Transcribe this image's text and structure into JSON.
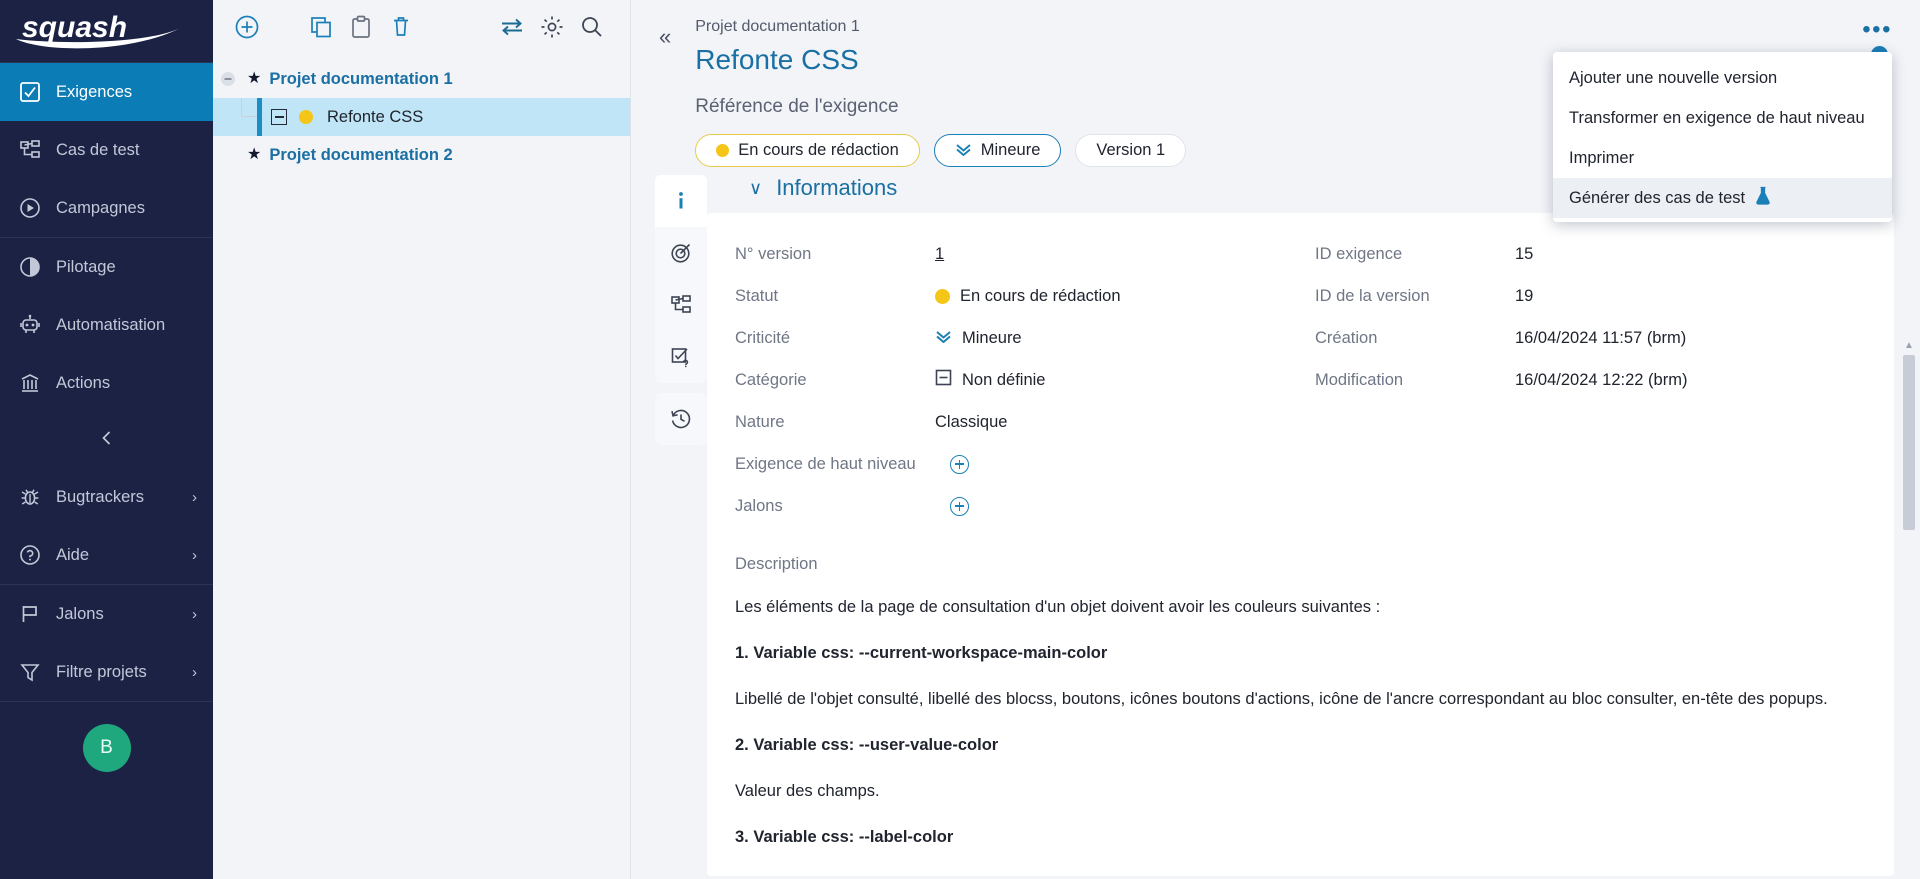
{
  "sidebar": {
    "logo_text": "squash",
    "items": [
      {
        "label": "Exigences",
        "icon": "checkbox-checked-icon",
        "active": true
      },
      {
        "label": "Cas de test",
        "icon": "test-case-tree-icon",
        "active": false
      },
      {
        "label": "Campagnes",
        "icon": "play-circle-icon",
        "active": false
      },
      {
        "label": "Pilotage",
        "icon": "pie-chart-icon",
        "active": false
      },
      {
        "label": "Automatisation",
        "icon": "robot-icon",
        "active": false
      },
      {
        "label": "Actions",
        "icon": "bank-icon",
        "active": false
      }
    ],
    "items_bottom": [
      {
        "label": "Bugtrackers",
        "icon": "bug-icon",
        "chevron": "›"
      },
      {
        "label": "Aide",
        "icon": "question-circle-icon",
        "chevron": "›"
      },
      {
        "label": "Jalons",
        "icon": "flag-icon",
        "chevron": "›"
      },
      {
        "label": "Filtre projets",
        "icon": "funnel-icon",
        "chevron": "›"
      }
    ],
    "collapse_icon": "chevron-left-icon",
    "avatar_initial": "B"
  },
  "tree": {
    "toolbar": [
      {
        "name": "add-icon",
        "title": "Ajouter"
      },
      {
        "name": "copy-icon",
        "title": "Copier"
      },
      {
        "name": "paste-clipboard-icon",
        "title": "Coller"
      },
      {
        "name": "trash-icon",
        "title": "Supprimer"
      },
      {
        "name": "transfer-arrows-icon",
        "title": "Déplacer"
      },
      {
        "name": "gear-icon",
        "title": "Paramètres"
      },
      {
        "name": "search-icon",
        "title": "Rechercher"
      }
    ],
    "nodes": [
      {
        "label": "Projet documentation 1",
        "level": 0,
        "expander": "minus",
        "icon": "star-icon",
        "selected": false
      },
      {
        "label": "Refonte CSS",
        "level": 1,
        "expander": "square-minus",
        "icon": "yellow-dot",
        "selected": true
      },
      {
        "label": "Projet documentation 2",
        "level": 0,
        "expander": "none",
        "icon": "star-icon",
        "selected": false
      }
    ]
  },
  "header": {
    "collapse_icon": "double-chevron-left-icon",
    "breadcrumb": "Projet documentation 1",
    "title": "Refonte CSS",
    "subtitle": "Référence de l'exigence",
    "badges": [
      {
        "label": "En cours de rédaction",
        "kind": "status",
        "icon": "yellow-dot"
      },
      {
        "label": "Mineure",
        "kind": "criticality",
        "icon": "double-chevron-down-icon"
      },
      {
        "label": "Version 1",
        "kind": "version",
        "icon": "none"
      }
    ],
    "kebab_icon": "more-options-icon",
    "kebab_glyph": "•••"
  },
  "dropdown": {
    "items": [
      {
        "label": "Ajouter une nouvelle version",
        "icon": "none",
        "highlighted": false
      },
      {
        "label": "Transformer en exigence de haut niveau",
        "icon": "none",
        "highlighted": false
      },
      {
        "label": "Imprimer",
        "icon": "none",
        "highlighted": false
      },
      {
        "label": "Générer des cas de test",
        "icon": "flask-icon",
        "highlighted": true
      }
    ]
  },
  "rail": {
    "items": [
      {
        "name": "information-icon",
        "active": true
      },
      {
        "name": "target-coverage-icon",
        "active": false
      },
      {
        "name": "hierarchy-tree-icon",
        "active": false
      },
      {
        "name": "verify-checklist-icon",
        "active": false
      }
    ],
    "items_bottom": [
      {
        "name": "history-clock-icon",
        "active": false
      }
    ]
  },
  "informations": {
    "section_title": "Informations",
    "collapse_glyph": "∨",
    "left_fields": [
      {
        "label": "N° version",
        "value": "1",
        "icon": "none",
        "underlined": true
      },
      {
        "label": "Statut",
        "value": "En cours de rédaction",
        "icon": "yellow-dot"
      },
      {
        "label": "Criticité",
        "value": "Mineure",
        "icon": "double-chevron-down-icon"
      },
      {
        "label": "Catégorie",
        "value": "Non définie",
        "icon": "square-minus-icon"
      },
      {
        "label": "Nature",
        "value": "Classique",
        "icon": "none"
      },
      {
        "label": "Exigence de haut niveau",
        "value": "",
        "icon": "plus-circle-icon"
      },
      {
        "label": "Jalons",
        "value": "",
        "icon": "plus-circle-icon"
      }
    ],
    "right_fields": [
      {
        "label": "ID exigence",
        "value": "15"
      },
      {
        "label": "ID de la version",
        "value": "19"
      },
      {
        "label": "Création",
        "value": "16/04/2024 11:57 (brm)"
      },
      {
        "label": "Modification",
        "value": "16/04/2024 12:22 (brm)"
      }
    ],
    "description_label": "Description",
    "description_blocks": [
      {
        "text": "Les éléments de la page de consultation d'un objet doivent avoir les couleurs suivantes :",
        "bold": false
      },
      {
        "text": "1. Variable css: --current-workspace-main-color",
        "bold": true
      },
      {
        "text": "Libellé de l'objet consulté,  libellé des blocss, boutons, icônes boutons d'actions, icône de l'ancre correspondant au bloc consulter, en-tête des popups.",
        "bold": false
      },
      {
        "text": "2. Variable css: --user-value-color",
        "bold": true
      },
      {
        "text": "Valeur des champs.",
        "bold": false
      },
      {
        "text": "3. Variable css: --label-color",
        "bold": true
      }
    ]
  },
  "colors": {
    "sidebar_bg": "#1b2244",
    "accent_blue": "#1a6fa3",
    "active_nav": "#0b7cb5",
    "status_yellow": "#f5c518",
    "avatar_green": "#1fa87e",
    "selection_blue": "#bfe5f7"
  }
}
